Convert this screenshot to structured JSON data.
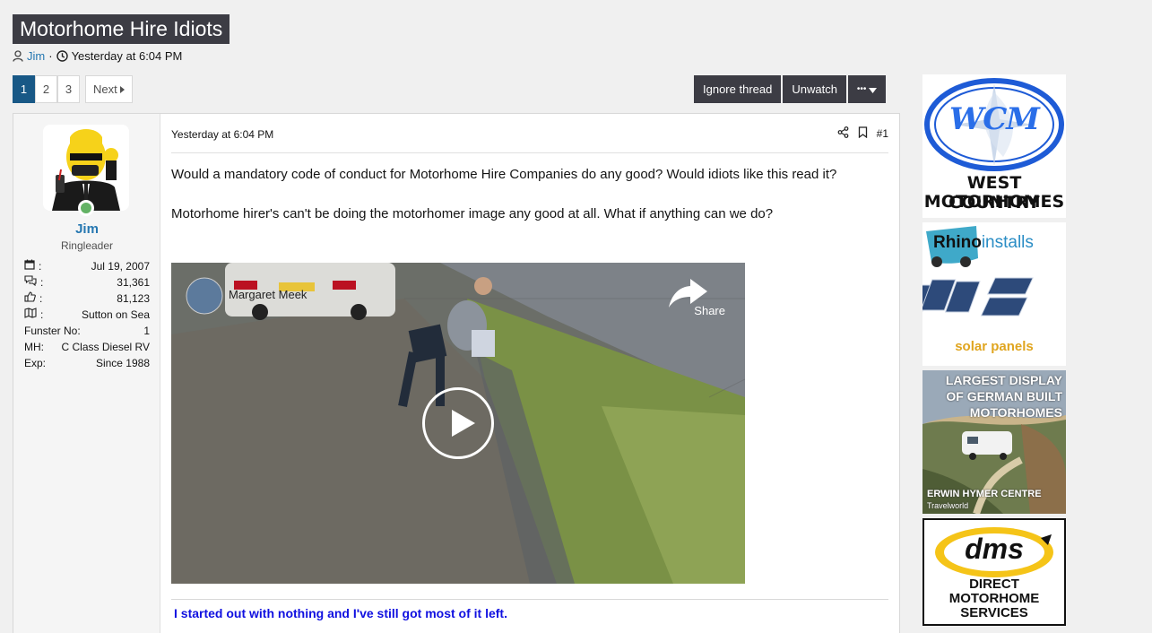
{
  "thread": {
    "title": "Motorhome Hire Idiots",
    "author": "Jim",
    "separator": "·",
    "date": "Yesterday at 6:04 PM"
  },
  "pagination": {
    "pages": [
      "1",
      "2",
      "3"
    ],
    "active_page": "1",
    "next_label": "Next"
  },
  "actions": {
    "ignore_label": "Ignore thread",
    "unwatch_label": "Unwatch",
    "more_label": "•••"
  },
  "user": {
    "name": "Jim",
    "title": "Ringleader",
    "stats": [
      {
        "icon": "calendar-icon",
        "label": ":",
        "value": "Jul 19, 2007"
      },
      {
        "icon": "messages-icon",
        "label": ":",
        "value": "31,361"
      },
      {
        "icon": "thumbs-up-icon",
        "label": ":",
        "value": "81,123"
      },
      {
        "icon": "map-icon",
        "label": ":",
        "value": "Sutton on Sea"
      },
      {
        "icon": "",
        "label": "Funster No:",
        "value": "1"
      },
      {
        "icon": "",
        "label": "MH:",
        "value": "C Class Diesel RV"
      },
      {
        "icon": "",
        "label": "Exp:",
        "value": "Since 1988"
      }
    ]
  },
  "post": {
    "date": "Yesterday at 6:04 PM",
    "number": "#1",
    "paragraphs": [
      "Would a mandatory code of conduct for Motorhome Hire Companies do any good? Would idiots like this read it?",
      "Motorhome hirer's can't be doing the motorhomer image any good at all. What if anything can we do?"
    ],
    "video": {
      "channel": "Margaret Meek",
      "share_label": "Share"
    },
    "signature": "I started out with nothing and I've still got most of it left."
  },
  "ads": [
    {
      "name": "west-country-motorhomes-ad",
      "logo": "WCM",
      "line1": "WEST COUNTRY",
      "line2": "MOTORHOMES"
    },
    {
      "name": "rhino-installs-ad",
      "brand1": "Rhino",
      "brand2": "installs",
      "caption": "solar panels"
    },
    {
      "name": "erwin-hymer-ad",
      "line1": "LARGEST DISPLAY",
      "line2": "OF GERMAN BUILT",
      "line3": "MOTORHOMES",
      "footer": "ERWIN HYMER CENTRE",
      "sub": "Travelworld"
    },
    {
      "name": "dms-ad",
      "logo": "dms",
      "line1": "DIRECT",
      "line2": "MOTORHOME",
      "line3": "SERVICES"
    }
  ],
  "colors": {
    "title_bg": "#3c3c44",
    "link": "#2577b1",
    "active_page": "#185886",
    "signature": "#1010e0",
    "online": "#63b265"
  }
}
